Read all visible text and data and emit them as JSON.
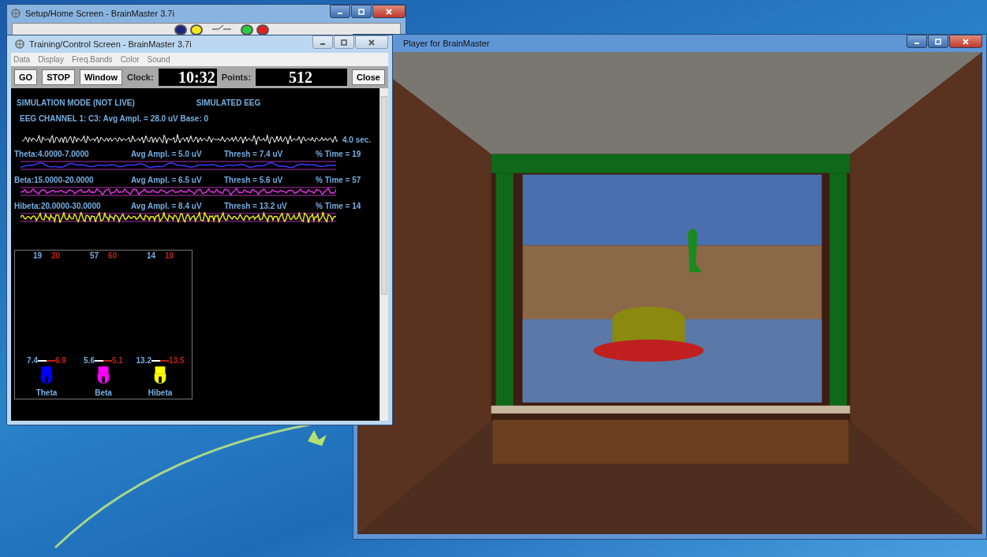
{
  "setup_window": {
    "title": "Setup/Home Screen - BrainMaster 3.7i",
    "status_buttons": [
      {
        "color": "#1a237e"
      },
      {
        "color": "#f5e61a"
      },
      {
        "color": "#2ecc40"
      },
      {
        "color": "#e02020"
      }
    ]
  },
  "player_window": {
    "title": "Player for BrainMaster"
  },
  "training_window": {
    "title": "Training/Control Screen - BrainMaster 3.7i",
    "menu": [
      "Data",
      "Display",
      "Freq.Bands",
      "Color",
      "Sound"
    ],
    "toolbar": {
      "buttons": [
        "GO",
        "STOP",
        "Window"
      ],
      "clock_label": "Clock:",
      "clock": "10:32",
      "points_label": "Points:",
      "points": "512",
      "close": "Close"
    },
    "mode": "SIMULATION MODE (NOT LIVE)",
    "source": "SIMULATED EEG",
    "channel": "EEG CHANNEL 1: C3: Avg Ampl. = 28.0 uV  Base: 0",
    "duration": "4.0 sec.",
    "bands": [
      {
        "name": "Theta:4.0000-7.0000",
        "avg": "Avg Ampl. = 5.0 uV",
        "thresh": "Thresh = 7.4 uV",
        "time": "% Time = 19",
        "color": "#3a3aff"
      },
      {
        "name": "Beta:15.0000-20.0000",
        "avg": "Avg Ampl. = 6.5 uV",
        "thresh": "Thresh = 5.6 uV",
        "time": "% Time = 57",
        "color": "#e030e0"
      },
      {
        "name": "Hibeta:20.0000-30.0000",
        "avg": "Avg Ampl. = 8.4 uV",
        "thresh": "Thresh = 13.2 uV",
        "time": "% Time = 14",
        "color": "#e8e020"
      }
    ],
    "meters": [
      {
        "percent": "19",
        "target": "20",
        "threshold": "7.4",
        "current": "6.9",
        "label": "Theta",
        "color": "#0000ff"
      },
      {
        "percent": "57",
        "target": "60",
        "threshold": "5.6",
        "current": "5.1",
        "label": "Beta",
        "color": "#ff00ff"
      },
      {
        "percent": "14",
        "target": "10",
        "threshold": "13.2",
        "current": "13.5",
        "label": "Hibeta",
        "color": "#ffff00"
      }
    ]
  }
}
